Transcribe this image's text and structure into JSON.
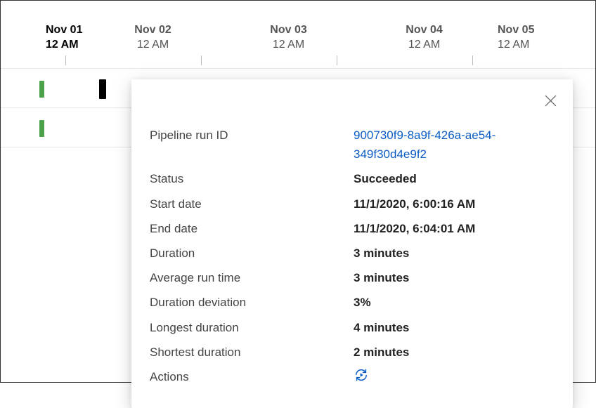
{
  "timeline": {
    "dates": [
      {
        "date": "Nov 01",
        "time": "12 AM",
        "emphasis": true
      },
      {
        "date": "Nov 02",
        "time": "12 AM",
        "emphasis": false
      },
      {
        "date": "Nov 03",
        "time": "12 AM",
        "emphasis": false
      },
      {
        "date": "Nov 04",
        "time": "12 AM",
        "emphasis": false
      },
      {
        "date": "Nov 05",
        "time": "12 AM",
        "emphasis": false
      }
    ]
  },
  "details": {
    "run_id_label": "Pipeline run ID",
    "run_id_value": "900730f9-8a9f-426a-ae54-349f30d4e9f2",
    "status_label": "Status",
    "status_value": "Succeeded",
    "start_label": "Start date",
    "start_value": "11/1/2020, 6:00:16 AM",
    "end_label": "End date",
    "end_value": "11/1/2020, 6:04:01 AM",
    "duration_label": "Duration",
    "duration_value": "3 minutes",
    "avg_label": "Average run time",
    "avg_value": "3 minutes",
    "dev_label": "Duration deviation",
    "dev_value": "3%",
    "longest_label": "Longest duration",
    "longest_value": "4 minutes",
    "shortest_label": "Shortest duration",
    "shortest_value": "2 minutes",
    "actions_label": "Actions"
  }
}
